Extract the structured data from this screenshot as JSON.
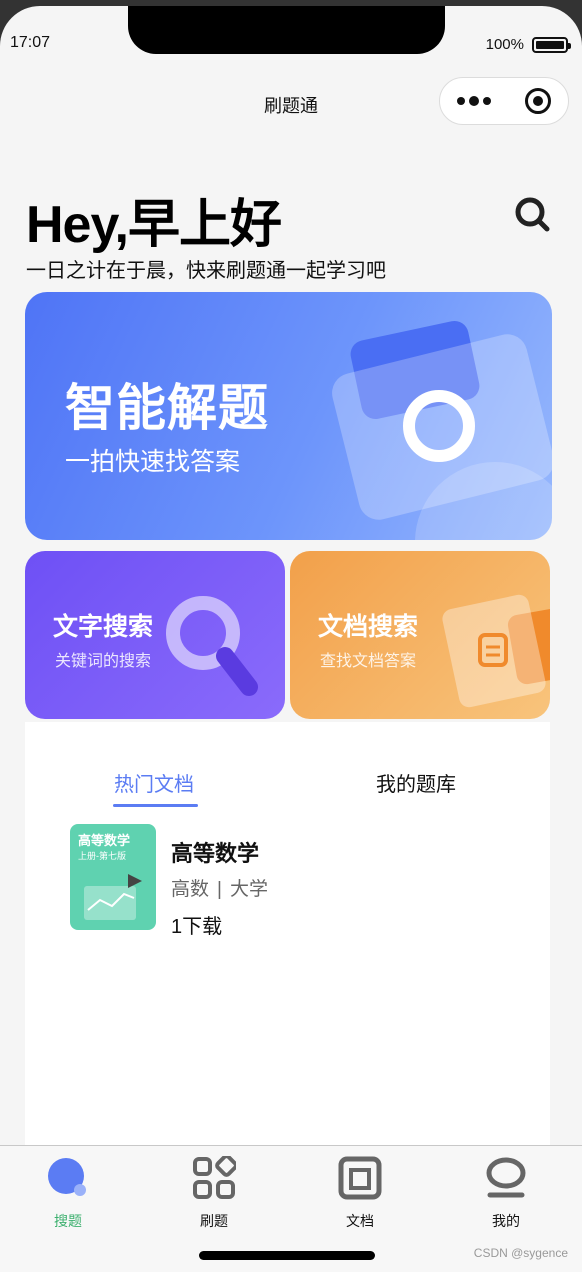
{
  "status_bar": {
    "time": "17:07",
    "battery": "100%",
    "battery_level": 1.0
  },
  "navbar": {
    "title": "刷题通"
  },
  "header": {
    "greeting": "Hey,早上好",
    "subtitle": "一日之计在于晨，快来刷题通一起学习吧"
  },
  "hero_card": {
    "title": "智能解题",
    "subtitle": "一拍快速找答案"
  },
  "feature_cards": [
    {
      "title": "文字搜索",
      "subtitle": "关键词的搜索",
      "icon": "magnifier-icon"
    },
    {
      "title": "文档搜索",
      "subtitle": "查找文档答案",
      "icon": "document-icon"
    }
  ],
  "tabs": [
    {
      "label": "热门文档",
      "active": true
    },
    {
      "label": "我的题库",
      "active": false
    }
  ],
  "documents": [
    {
      "name": "高等数学",
      "category": "高数",
      "level": "大学",
      "downloads": "1下载",
      "cover_title": "高等数学",
      "cover_sub": "上册-第七版"
    }
  ],
  "tabbar": [
    {
      "label": "搜题",
      "icon": "search-ball-icon",
      "active": true
    },
    {
      "label": "刷题",
      "icon": "grid-icon",
      "active": false
    },
    {
      "label": "文档",
      "icon": "document-icon",
      "active": false
    },
    {
      "label": "我的",
      "icon": "profile-icon",
      "active": false
    }
  ],
  "watermark": "CSDN @sygence",
  "colors": {
    "accent": "#5b7cf3",
    "hero": "#4f74f6",
    "text_card": "#6e50f5",
    "doc_card": "#f2a04a",
    "tabbar_active": "#3db06f"
  }
}
